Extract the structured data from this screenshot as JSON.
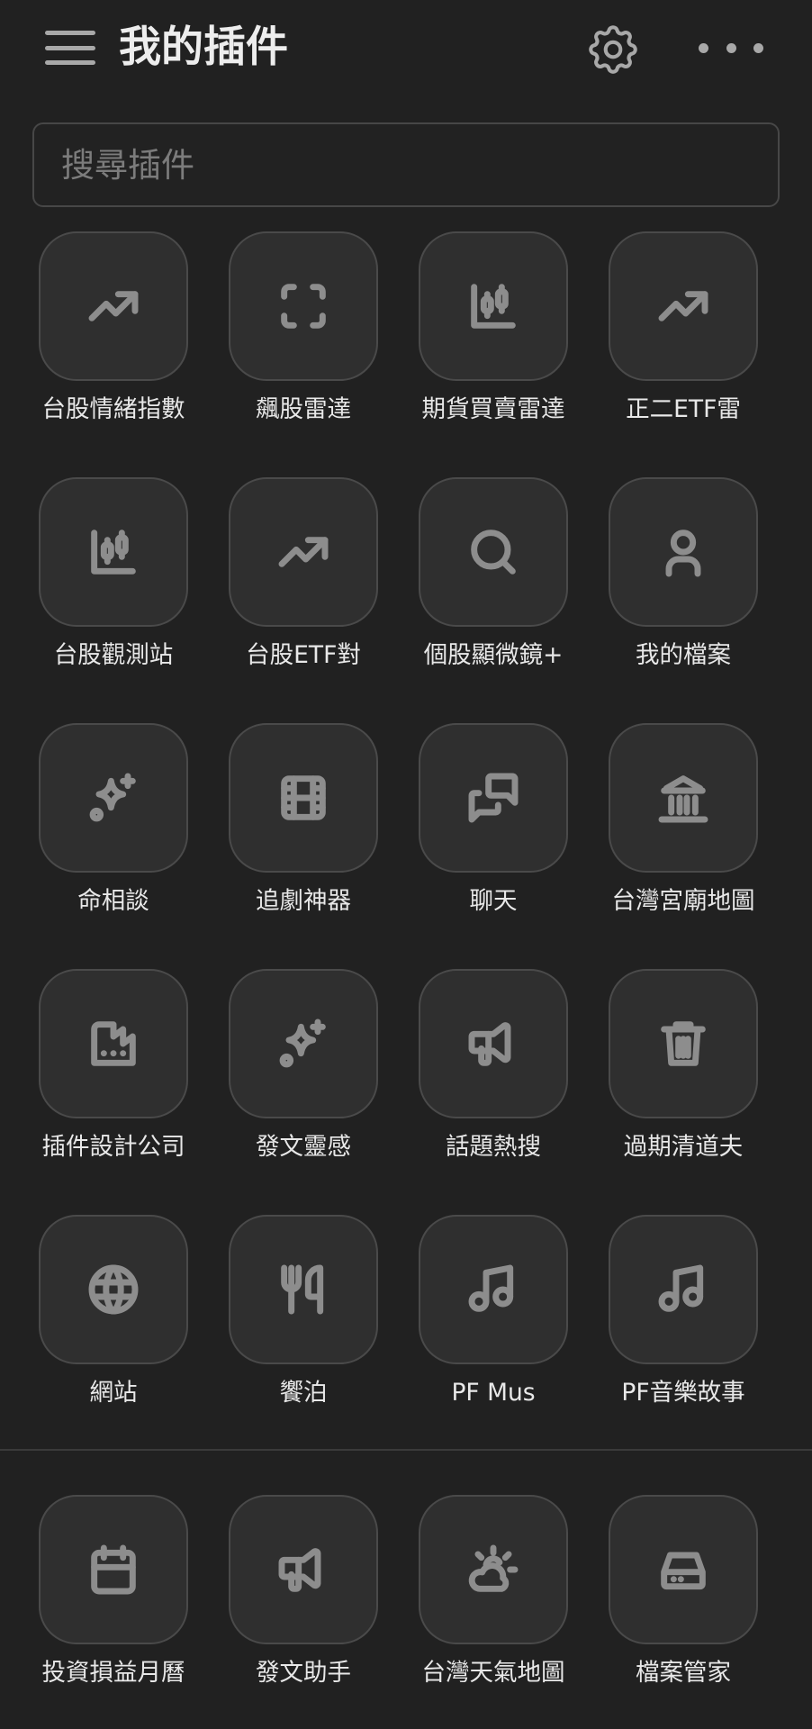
{
  "header": {
    "title": "我的插件"
  },
  "search": {
    "placeholder": "搜尋插件",
    "value": ""
  },
  "plugins": [
    {
      "label": "台股情緒指數",
      "icon": "trending-up-icon"
    },
    {
      "label": "飆股雷達",
      "icon": "scan-frame-icon"
    },
    {
      "label": "期貨買賣雷達",
      "icon": "candlestick-chart-icon"
    },
    {
      "label": "正二ETF雷",
      "icon": "trending-up-icon"
    },
    {
      "label": "台股觀測站",
      "icon": "candlestick-chart-icon"
    },
    {
      "label": "台股ETF對",
      "icon": "trending-up-icon"
    },
    {
      "label": "個股顯微鏡+",
      "icon": "search-icon"
    },
    {
      "label": "我的檔案",
      "icon": "user-icon"
    },
    {
      "label": "命相談",
      "icon": "sparkles-icon"
    },
    {
      "label": "追劇神器",
      "icon": "film-icon"
    },
    {
      "label": "聊天",
      "icon": "chat-bubbles-icon"
    },
    {
      "label": "台灣宮廟地圖",
      "icon": "temple-icon"
    },
    {
      "label": "插件設計公司",
      "icon": "factory-icon"
    },
    {
      "label": "發文靈感",
      "icon": "sparkles-icon"
    },
    {
      "label": "話題熱搜",
      "icon": "megaphone-icon"
    },
    {
      "label": "過期清道夫",
      "icon": "trash-icon"
    },
    {
      "label": "網站",
      "icon": "globe-icon"
    },
    {
      "label": "饗泊",
      "icon": "utensils-icon"
    },
    {
      "label": "PF Mus",
      "icon": "music-icon"
    },
    {
      "label": "PF音樂故事",
      "icon": "music-icon"
    }
  ],
  "dock": [
    {
      "label": "投資損益月曆",
      "icon": "calendar-icon"
    },
    {
      "label": "發文助手",
      "icon": "megaphone-icon"
    },
    {
      "label": "台灣天氣地圖",
      "icon": "sun-cloud-icon"
    },
    {
      "label": "檔案管家",
      "icon": "hard-drive-icon"
    }
  ]
}
